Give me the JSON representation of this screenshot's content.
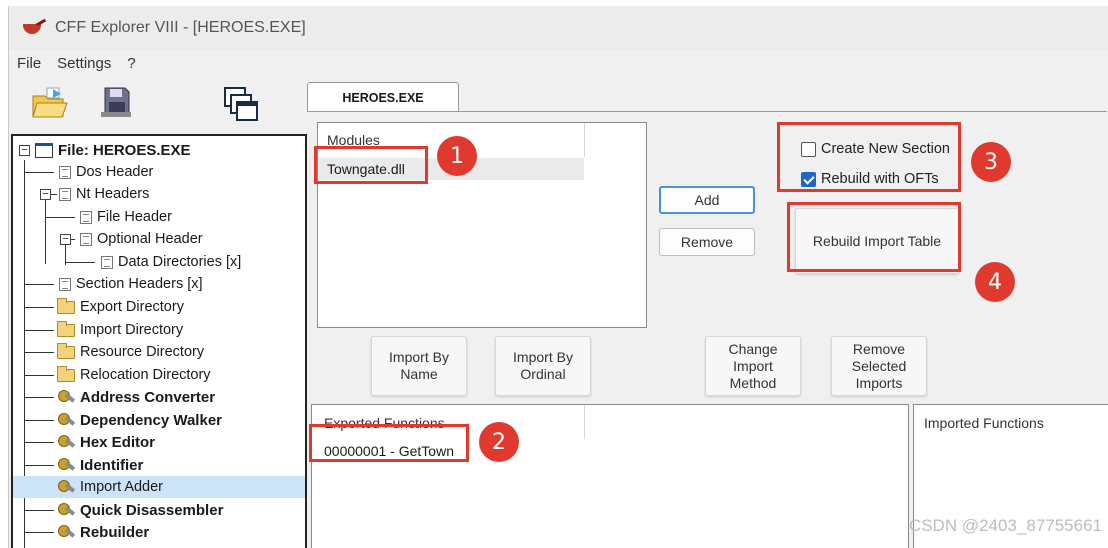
{
  "window": {
    "title": "CFF Explorer VIII - [HEROES.EXE]"
  },
  "menu": [
    "File",
    "Settings",
    "?"
  ],
  "toolbar": [
    {
      "name": "open-file-icon"
    },
    {
      "name": "save-icon"
    },
    {
      "name": "windows-icon"
    }
  ],
  "tree": {
    "root": "File: HEROES.EXE",
    "items": [
      "Dos Header",
      "Nt Headers",
      "File Header",
      "Optional Header",
      "Data Directories [x]",
      "Section Headers [x]",
      "Export Directory",
      "Import Directory",
      "Resource Directory",
      "Relocation Directory",
      "Address Converter",
      "Dependency Walker",
      "Hex Editor",
      "Identifier",
      "Import Adder",
      "Quick Disassembler",
      "Rebuilder"
    ],
    "selected": "Import Adder"
  },
  "tab": {
    "label": "HEROES.EXE"
  },
  "modules": {
    "header": "Modules",
    "items": [
      "Towngate.dll"
    ]
  },
  "buttons": {
    "add": "Add",
    "remove": "Remove",
    "rebuild_import_table": "Rebuild Import Table",
    "import_by_name": "Import By Name",
    "import_by_ordinal": "Import By Ordinal",
    "change_import_method": "Change Import Method",
    "remove_selected_imports": "Remove Selected Imports"
  },
  "options": {
    "create_new_section": {
      "label": "Create New Section",
      "checked": false
    },
    "rebuild_with_ofts": {
      "label": "Rebuild with OFTs",
      "checked": true
    }
  },
  "exported": {
    "header": "Exported Functions",
    "items": [
      "00000001 - GetTown"
    ]
  },
  "imported": {
    "header": "Imported Functions"
  },
  "badges": [
    "1",
    "2",
    "3",
    "4"
  ],
  "watermark": "CSDN @2403_87755661",
  "colors": {
    "annotation_red": "#e03a2f",
    "selection": "#cce4f7",
    "checkbox_blue": "#1f66c6"
  }
}
